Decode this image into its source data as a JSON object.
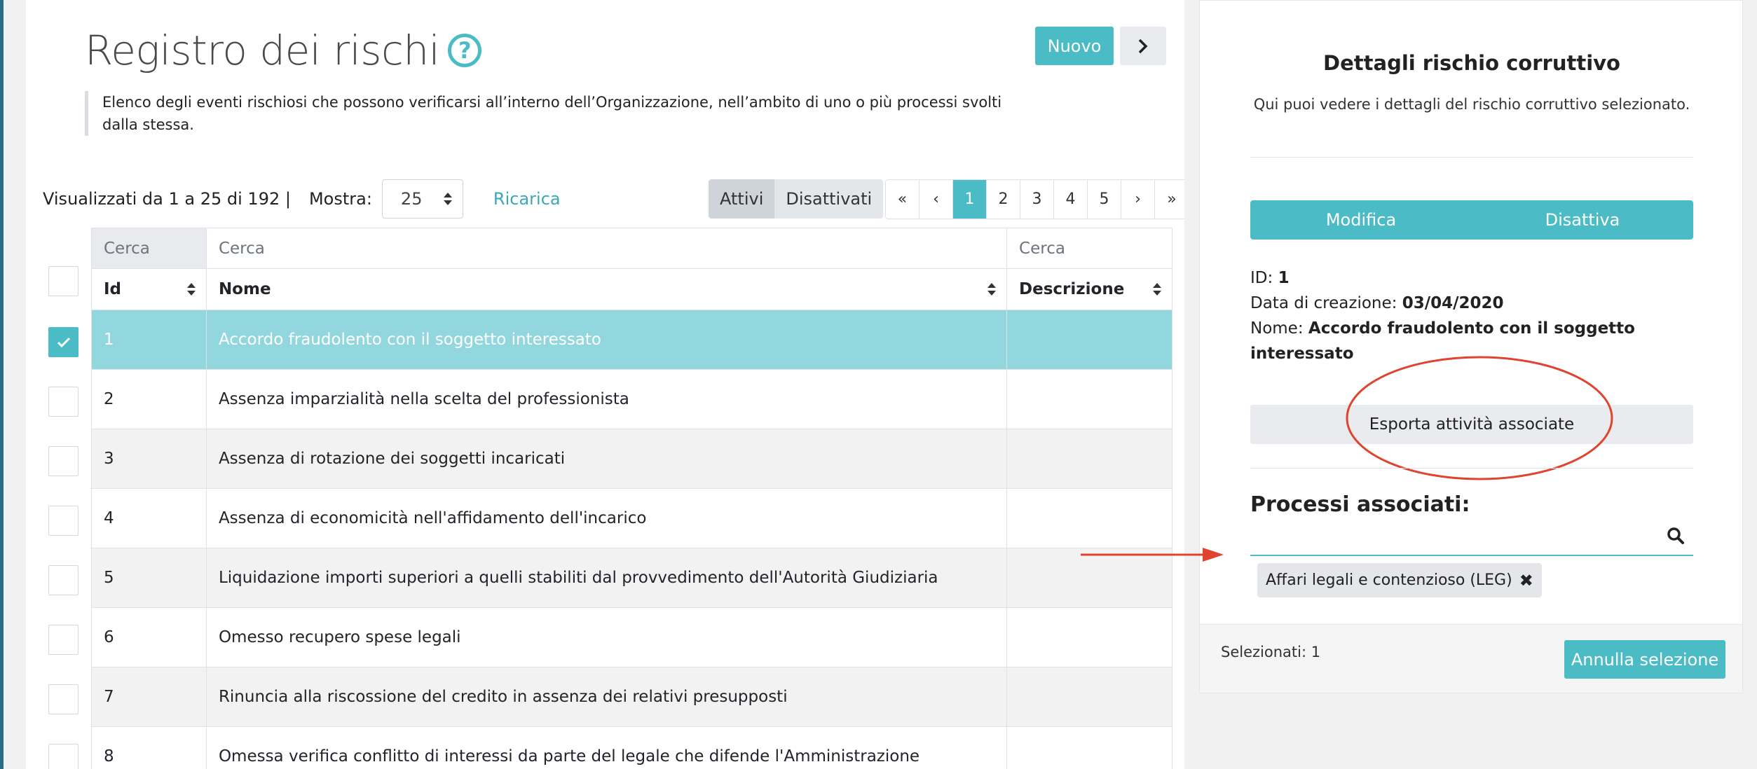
{
  "header": {
    "title": "Registro dei rischi",
    "help_symbol": "?",
    "new_label": "Nuovo",
    "description": "Elenco degli eventi rischiosi che possono verificarsi all’interno dell’Organizzazione, nell’ambito di uno o più processi svolti dalla stessa."
  },
  "toolbar": {
    "records_info": "Visualizzati da 1 a 25 di 192 |",
    "show_label": "Mostra:",
    "page_size": "25",
    "reload_label": "Ricarica",
    "filters": [
      "Attivi",
      "Disattivati"
    ]
  },
  "pagination": {
    "first": "«",
    "prev": "‹",
    "pages": [
      "1",
      "2",
      "3",
      "4",
      "5"
    ],
    "current": "1",
    "next": "›",
    "last": "»"
  },
  "table": {
    "search_placeholders": [
      "Cerca",
      "Cerca",
      "Cerca"
    ],
    "columns": [
      "Id",
      "Nome",
      "Descrizione"
    ],
    "rows": [
      {
        "id": "1",
        "nome": "Accordo fraudolento con il soggetto interessato",
        "descrizione": "",
        "selected": true
      },
      {
        "id": "2",
        "nome": "Assenza imparzialità nella scelta del professionista",
        "descrizione": ""
      },
      {
        "id": "3",
        "nome": "Assenza di rotazione dei soggetti incaricati",
        "descrizione": ""
      },
      {
        "id": "4",
        "nome": "Assenza di economicità nell'affidamento dell'incarico",
        "descrizione": ""
      },
      {
        "id": "5",
        "nome": "Liquidazione importi superiori a quelli stabiliti dal provvedimento dell'Autorità Giudiziaria",
        "descrizione": ""
      },
      {
        "id": "6",
        "nome": "Omesso recupero spese legali",
        "descrizione": ""
      },
      {
        "id": "7",
        "nome": "Rinuncia alla riscossione del credito in assenza dei relativi presupposti",
        "descrizione": ""
      },
      {
        "id": "8",
        "nome": "Omessa verifica conflitto di interessi da parte del legale che difende l'Amministrazione",
        "descrizione": ""
      }
    ]
  },
  "details": {
    "title": "Dettagli rischio corruttivo",
    "subtitle": "Qui puoi vedere i dettagli del rischio corruttivo selezionato.",
    "edit_label": "Modifica",
    "disable_label": "Disattiva",
    "id_label": "ID:",
    "id_value": "1",
    "created_label": "Data di creazione:",
    "created_value": "03/04/2020",
    "name_label": "Nome:",
    "name_value": "Accordo fraudolento con il soggetto interessato",
    "export_label": "Esporta attività associate",
    "processes_title": "Processi associati:",
    "process_tags": [
      "Affari legali e contenzioso (LEG)"
    ],
    "remove_symbol": "✖",
    "selected_info": "Selezionati: 1",
    "cancel_selection_label": "Annulla selezione"
  },
  "colors": {
    "accent": "#4bbcc6",
    "selected_row": "#93d7de",
    "annotation": "#e0432f"
  },
  "icons": {
    "help": "question-circle-icon",
    "next": "chevron-right-icon",
    "select": "select-updown-icon",
    "sort": "sort-icon",
    "check": "check-icon",
    "search": "search-icon",
    "remove": "times-icon"
  }
}
